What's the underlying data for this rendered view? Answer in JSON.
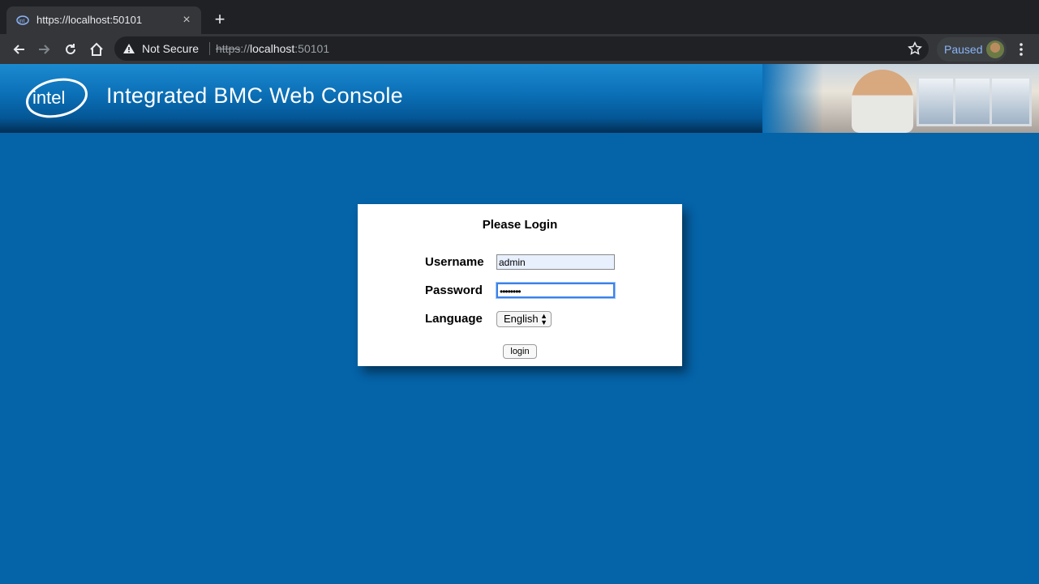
{
  "browser": {
    "tab_title": "https://localhost:50101",
    "tab_close": "×",
    "new_tab": "+",
    "security_label": "Not Secure",
    "url_scheme": "https",
    "url_sep": "://",
    "url_host": "localhost",
    "url_port": ":50101",
    "profile_status": "Paused"
  },
  "banner": {
    "logo_text": "intel",
    "title": "Integrated BMC Web Console"
  },
  "login": {
    "heading": "Please Login",
    "username_label": "Username",
    "username_value": "admin",
    "password_label": "Password",
    "password_value": "••••••••",
    "language_label": "Language",
    "language_value": "English",
    "button_label": "login"
  }
}
